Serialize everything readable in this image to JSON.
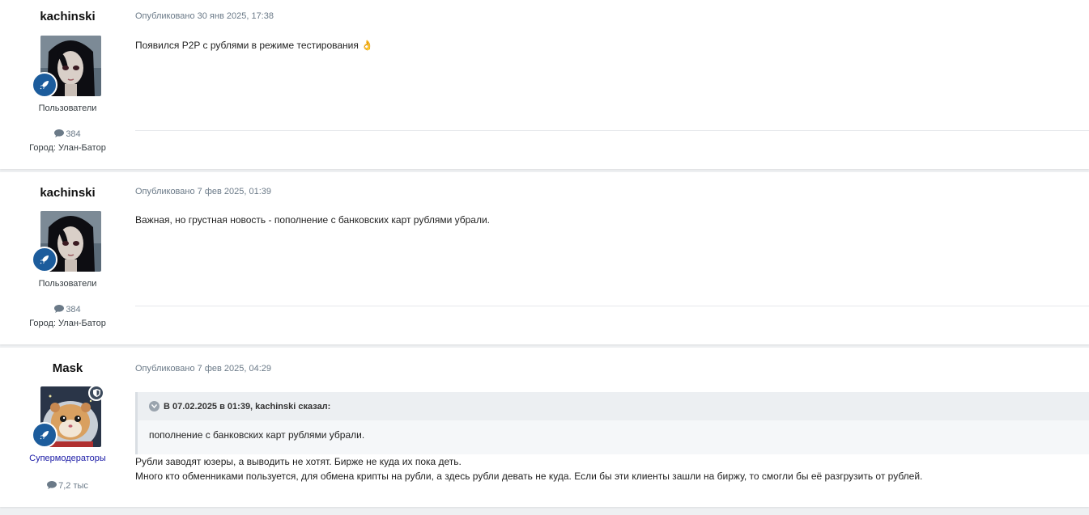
{
  "posts": [
    {
      "author": "kachinski",
      "group": "Пользователи",
      "post_count": "384",
      "city": "Город: Улан-Батор",
      "date": "Опубликовано 30 янв 2025, 17:38",
      "body": "Появился P2P с рублями в режиме тестирования 👌"
    },
    {
      "author": "kachinski",
      "group": "Пользователи",
      "post_count": "384",
      "city": "Город: Улан-Батор",
      "date": "Опубликовано 7 фев 2025, 01:39",
      "body": "Важная, но грустная новость - пополнение с банковских карт рублями убрали."
    },
    {
      "author": "Mask",
      "group": "Супермодераторы",
      "post_count": "7,2 тыс",
      "date": "Опубликовано 7 фев 2025, 04:29",
      "quote": {
        "header": "В 07.02.2025 в 01:39, kachinski сказал:",
        "text": "пополнение с банковских карт рублями убрали."
      },
      "body_lines": [
        "Рубли заводят юзеры, а выводить не хотят. Бирже не куда их пока деть.",
        "Много кто обменниками пользуется, для обмена крипты на рубли, а здесь рубли девать не куда. Если бы эти клиенты зашли на биржу, то смогли бы её разгрузить от рублей."
      ]
    }
  ],
  "icons": {
    "rank": "rocket-icon",
    "posts": "comment-icon",
    "moderator": "shield-icon",
    "quote_toggle": "chevron-down-icon"
  },
  "colors": {
    "rank_badge": "#1c5c9c",
    "moderator_group": "#1a1aa6",
    "meta_text": "#6b7a88"
  }
}
